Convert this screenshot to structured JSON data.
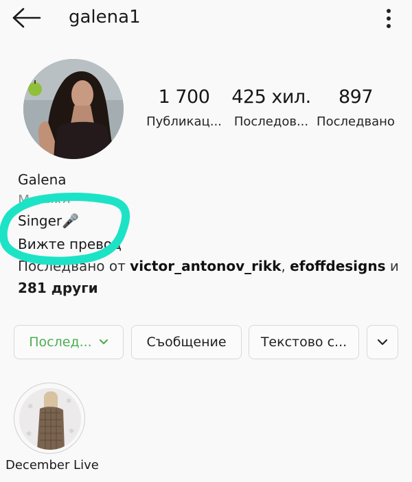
{
  "header": {
    "username": "galena1",
    "back_icon": "arrow-left-icon",
    "more_icon": "more-vertical-icon"
  },
  "stats": [
    {
      "number": "1 700",
      "label": "Публикац..."
    },
    {
      "number": "425 хил.",
      "label": "Последов..."
    },
    {
      "number": "897",
      "label": "Последвано"
    }
  ],
  "bio": {
    "name": "Galena",
    "category": "Музика",
    "line1": "Singer🎤",
    "line2": "Вижте превод",
    "followed_by_prefix": "Последвано от ",
    "followed_user1": "victor_antonov_rikk",
    "followed_sep": ", ",
    "followed_user2": "efoffdesigns",
    "followed_and": " и",
    "followed_line2": "281 други"
  },
  "buttons": {
    "following": "Послед...",
    "message": "Съобщение",
    "email": "Текстово с...",
    "expand_icon": "chevron-down-icon"
  },
  "highlight": {
    "label": "December Live"
  },
  "colors": {
    "accent_green": "#4caf50",
    "annotation_cyan": "#1de3c6"
  }
}
